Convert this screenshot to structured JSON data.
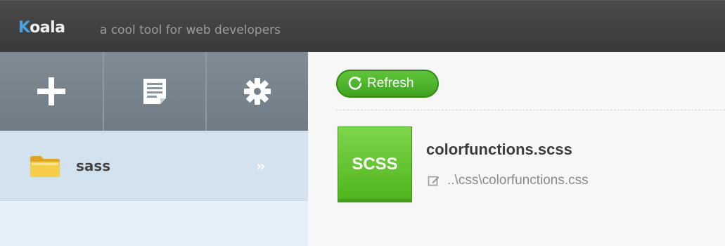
{
  "app": {
    "name_first": "K",
    "name_rest": "oala",
    "tagline": "a cool tool for web developers"
  },
  "sidebar": {
    "toolbar": [
      {
        "icon": "plus-icon"
      },
      {
        "icon": "document-icon"
      },
      {
        "icon": "gear-icon"
      }
    ],
    "projects": [
      {
        "name": "sass",
        "chevron": "››"
      }
    ]
  },
  "main": {
    "refresh_label": "Refresh",
    "files": [
      {
        "type": "SCSS",
        "name": "colorfunctions.scss",
        "output": "..\\css\\colorfunctions.css"
      }
    ]
  },
  "colors": {
    "titlebar": "#3f3f3f",
    "accent_blue": "#4aa3df",
    "green": "#4eb51c",
    "sidebar_bg": "#e6f0f8",
    "toolbar_bg": "#76828c"
  }
}
